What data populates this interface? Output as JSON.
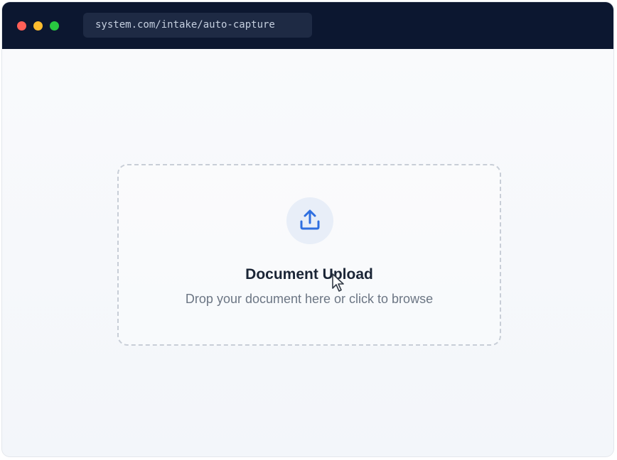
{
  "browser": {
    "address": "system.com/intake/auto-capture"
  },
  "upload": {
    "title": "Document Upload",
    "subtitle": "Drop your document here or click to browse",
    "icon": "upload-icon"
  },
  "colors": {
    "titlebar": "#0c1730",
    "accent": "#2f6fe0",
    "red": "#ff5f57",
    "yellow": "#febc2e",
    "green": "#28c840"
  }
}
